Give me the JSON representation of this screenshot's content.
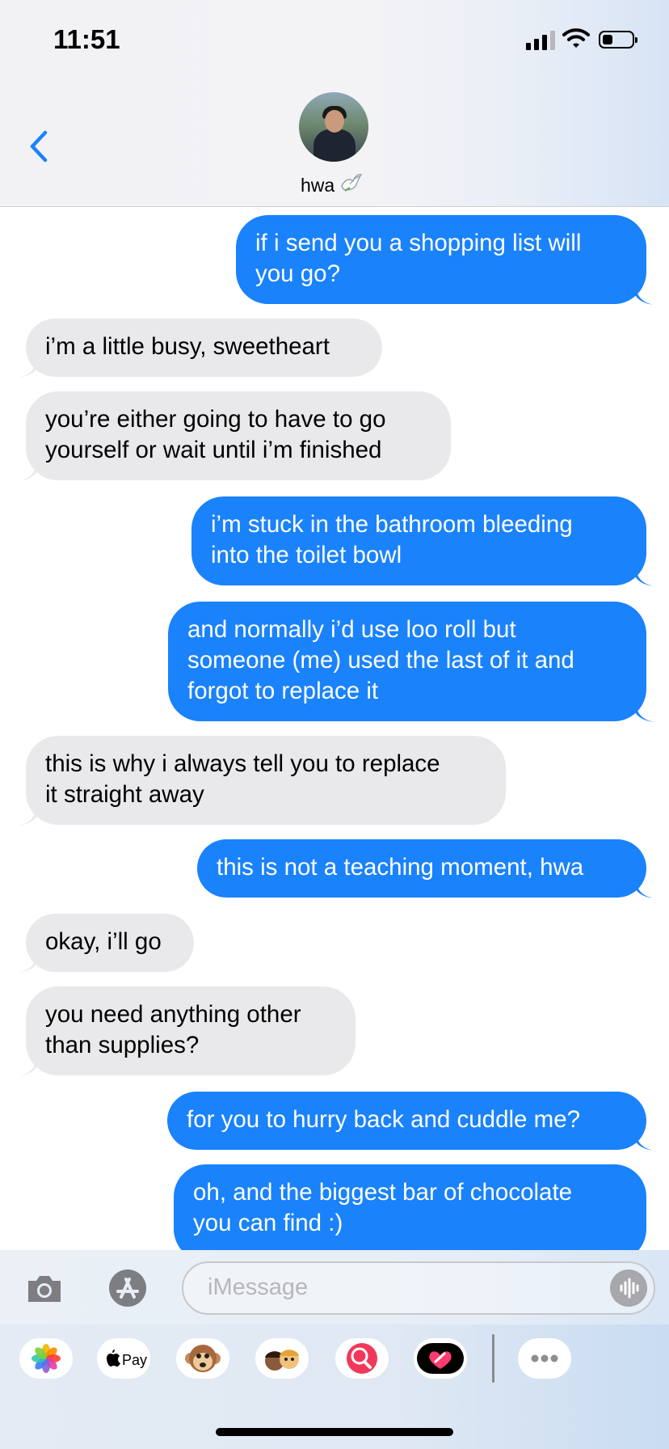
{
  "status_bar": {
    "time": "11:51"
  },
  "header": {
    "contact_name": "hwa",
    "contact_emoji": "dove-emoji"
  },
  "messages": [
    {
      "side": "out",
      "text": "if i send you a shopping list will\nyou go?"
    },
    {
      "side": "in",
      "text": "i’m a little busy, sweetheart"
    },
    {
      "side": "in",
      "text": "you’re either going to have to go\nyourself or wait until i’m finished"
    },
    {
      "side": "out",
      "text": "i’m stuck in the bathroom bleeding\ninto the toilet bowl"
    },
    {
      "side": "out",
      "text": "and normally i’d use loo roll but\nsomeone (me) used the last of it and\nforgot to replace it"
    },
    {
      "side": "in",
      "text": "this is why i always tell you to replace\nit straight away"
    },
    {
      "side": "out",
      "text": "this is not a teaching moment, hwa"
    },
    {
      "side": "in",
      "text": "okay, i’ll go"
    },
    {
      "side": "in",
      "text": "you need anything other\nthan supplies?"
    },
    {
      "side": "out",
      "text": "for you to hurry back and cuddle me?"
    },
    {
      "side": "out",
      "text": "oh, and the biggest bar of chocolate\nyou can find :)"
    }
  ],
  "input": {
    "placeholder": "iMessage"
  },
  "app_drawer": {
    "apple_pay_label": "Pay",
    "apps": [
      "photos-icon",
      "apple-pay-icon",
      "animoji-icon",
      "memoji-icon",
      "image-search-icon",
      "digital-touch-icon",
      "more-apps-icon"
    ]
  },
  "colors": {
    "outgoing": "#1a82fb",
    "incoming": "#e9e9eb",
    "accent": "#1a82fb"
  }
}
